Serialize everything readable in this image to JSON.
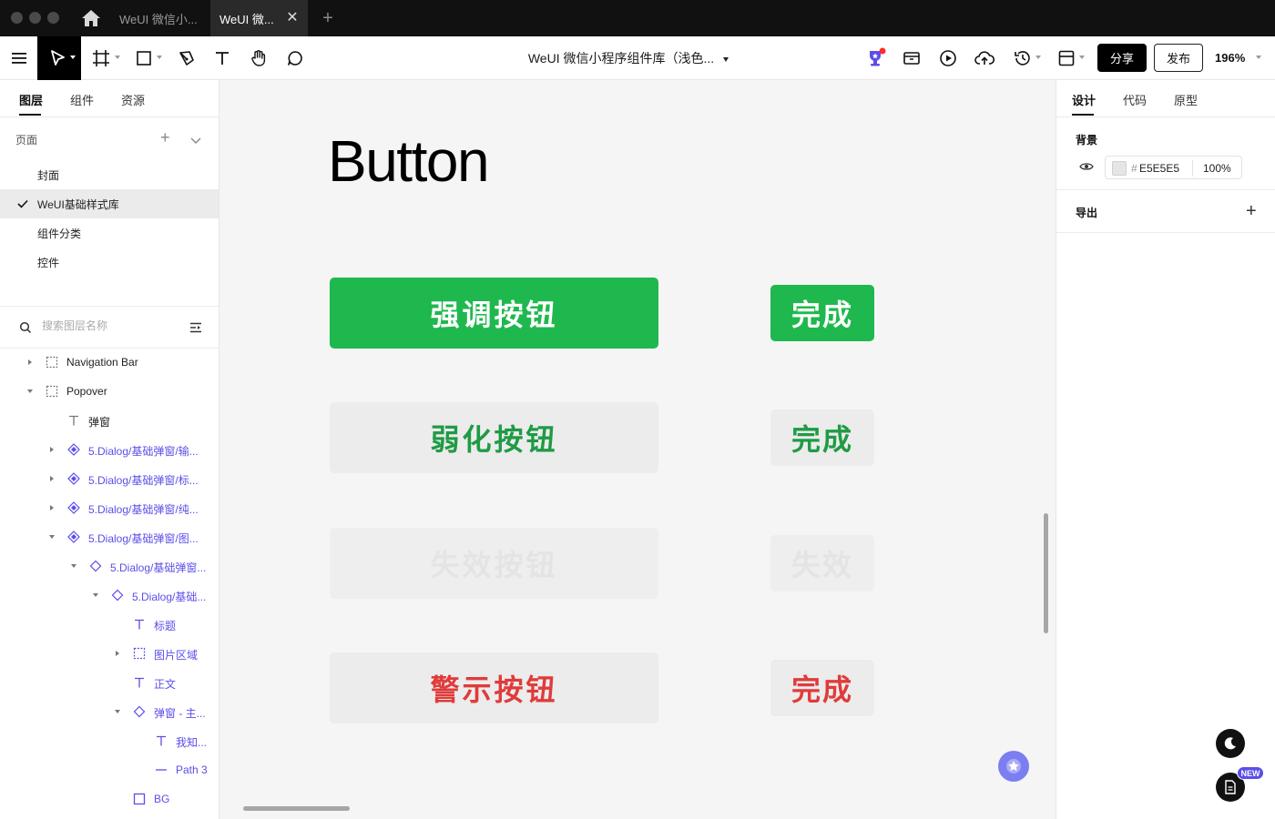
{
  "window": {
    "tabs": [
      {
        "label": "WeUI 微信小..."
      },
      {
        "label": "WeUI 微..."
      }
    ]
  },
  "toolbar": {
    "doc_title": "WeUI 微信小程序组件库（浅色...",
    "share_label": "分享",
    "publish_label": "发布",
    "zoom": "196%"
  },
  "left": {
    "tabs": [
      {
        "label": "图层"
      },
      {
        "label": "组件"
      },
      {
        "label": "资源"
      }
    ],
    "pages_label": "页面",
    "pages": [
      {
        "label": "封面"
      },
      {
        "label": "WeUI基础样式库"
      },
      {
        "label": "组件分类"
      },
      {
        "label": "控件"
      }
    ],
    "search_placeholder": "搜索图层名称",
    "layers": [
      {
        "label": "Navigation Bar"
      },
      {
        "label": "Popover"
      },
      {
        "label": "弹窗"
      },
      {
        "label": "5.Dialog/基础弹窗/输..."
      },
      {
        "label": "5.Dialog/基础弹窗/标..."
      },
      {
        "label": "5.Dialog/基础弹窗/纯..."
      },
      {
        "label": "5.Dialog/基础弹窗/图..."
      },
      {
        "label": "5.Dialog/基础弹窗..."
      },
      {
        "label": "5.Dialog/基础..."
      },
      {
        "label": "标题"
      },
      {
        "label": "图片区域"
      },
      {
        "label": "正文"
      },
      {
        "label": "弹窗 - 主..."
      },
      {
        "label": "我知..."
      },
      {
        "label": "Path 3"
      },
      {
        "label": "BG"
      }
    ]
  },
  "canvas": {
    "heading": "Button",
    "buttons": {
      "primary": "强调按钮",
      "primary_small": "完成",
      "secondary": "弱化按钮",
      "secondary_small": "完成",
      "disabled": "失效按钮",
      "disabled_small": "失效",
      "warn": "警示按钮",
      "warn_small": "完成"
    }
  },
  "right": {
    "tabs": [
      {
        "label": "设计"
      },
      {
        "label": "代码"
      },
      {
        "label": "原型"
      }
    ],
    "background_label": "背景",
    "hash": "#",
    "bg_hex": "E5E5E5",
    "bg_opacity": "100%",
    "export_label": "导出",
    "new_badge": "NEW"
  },
  "colors": {
    "primary_green": "#1fb84e",
    "secondary_green": "#1f9b45",
    "warn_red": "#e03b3b",
    "accent_purple": "#5b4ee8",
    "canvas_bg": "#f5f5f5"
  }
}
